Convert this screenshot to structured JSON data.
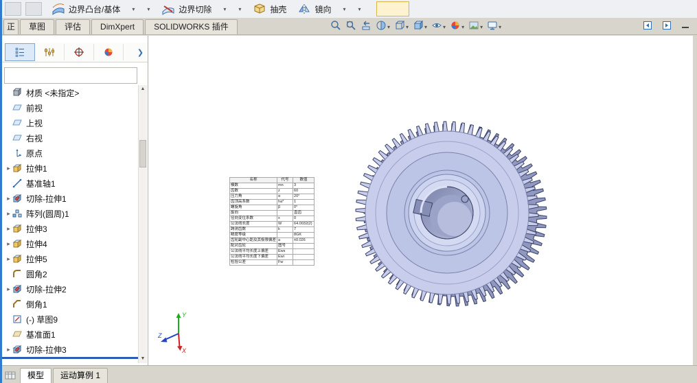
{
  "command_toolbar": {
    "groups": [
      {
        "label": "边界凸台/基体",
        "icon": "boundary-boss-icon"
      },
      {
        "label": "边界切除",
        "icon": "boundary-cut-icon"
      },
      {
        "label": "抽壳",
        "icon": "shell-icon"
      },
      {
        "label": "镜向",
        "icon": "mirror-icon"
      }
    ]
  },
  "command_tabs": [
    "正",
    "草图",
    "评估",
    "DimXpert",
    "SOLIDWORKS 插件"
  ],
  "heads_up_toolbar": {
    "items": [
      {
        "icon": "zoom-to-fit-icon",
        "caret": false
      },
      {
        "icon": "zoom-area-icon",
        "caret": false
      },
      {
        "icon": "previous-view-icon",
        "caret": false
      },
      {
        "icon": "section-view-icon",
        "caret": true
      },
      {
        "icon": "view-orientation-icon",
        "caret": true
      },
      {
        "icon": "display-style-icon",
        "caret": true
      },
      {
        "icon": "hide-show-items-icon",
        "caret": true
      },
      {
        "icon": "edit-appearance-icon",
        "caret": true
      },
      {
        "icon": "apply-scene-icon",
        "caret": true
      },
      {
        "icon": "view-settings-icon",
        "caret": true
      }
    ]
  },
  "feature_tree": {
    "items": [
      {
        "label": "材质 <未指定>",
        "icon": "material",
        "expandable": false
      },
      {
        "label": "前视",
        "icon": "plane",
        "expandable": false
      },
      {
        "label": "上视",
        "icon": "plane",
        "expandable": false
      },
      {
        "label": "右视",
        "icon": "plane",
        "expandable": false
      },
      {
        "label": "原点",
        "icon": "origin",
        "expandable": false
      },
      {
        "label": "拉伸1",
        "icon": "boss",
        "expandable": true
      },
      {
        "label": "基准轴1",
        "icon": "axis",
        "expandable": false
      },
      {
        "label": "切除-拉伸1",
        "icon": "cut",
        "expandable": true
      },
      {
        "label": "阵列(圆周)1",
        "icon": "pattern",
        "expandable": true
      },
      {
        "label": "拉伸3",
        "icon": "boss",
        "expandable": true
      },
      {
        "label": "拉伸4",
        "icon": "boss",
        "expandable": true
      },
      {
        "label": "拉伸5",
        "icon": "boss",
        "expandable": true
      },
      {
        "label": "圆角2",
        "icon": "fillet",
        "expandable": false
      },
      {
        "label": "切除-拉伸2",
        "icon": "cut",
        "expandable": true
      },
      {
        "label": "倒角1",
        "icon": "chamfer",
        "expandable": false
      },
      {
        "label": "(-) 草图9",
        "icon": "sketch",
        "expandable": false
      },
      {
        "label": "基准面1",
        "icon": "plane2",
        "expandable": false
      },
      {
        "label": "切除-拉伸3",
        "icon": "cut",
        "expandable": true
      }
    ]
  },
  "gear_table": {
    "headers": [
      "名称",
      "代号",
      "数值"
    ],
    "rows": [
      [
        "模数",
        "mn",
        "3"
      ],
      [
        "齿数",
        "z",
        "60"
      ],
      [
        "压力角",
        "α",
        "20°"
      ],
      [
        "齿顶高系数",
        "ha*",
        "1"
      ],
      [
        "螺旋角",
        "β",
        "0°"
      ],
      [
        "旋向",
        "",
        "直齿"
      ],
      [
        "径向变位系数",
        "x",
        "0"
      ],
      [
        "公法线长度",
        "W",
        "64.0032(2)"
      ],
      [
        "跨测齿数",
        "k",
        "7"
      ],
      [
        "精度等级",
        "",
        "8GK"
      ],
      [
        "齿轮副中心距及其极限偏差",
        "a",
        "±0.026"
      ],
      [
        "配对齿轮",
        "图号",
        ""
      ],
      [
        "公法线平均长度上偏差",
        "Ews",
        ""
      ],
      [
        "公法线平均长度下偏差",
        "Ewi",
        ""
      ],
      [
        "检验公差",
        "Fw",
        ""
      ]
    ]
  },
  "triad": {
    "x": "X",
    "y": "Y",
    "z": "Z"
  },
  "bottom_tabs": [
    "模型",
    "运动算例 1"
  ],
  "gear": {
    "teeth": 62,
    "face_color": "#c7cdeb",
    "side_color": "#9098bf",
    "outline_color": "#3a4166"
  }
}
